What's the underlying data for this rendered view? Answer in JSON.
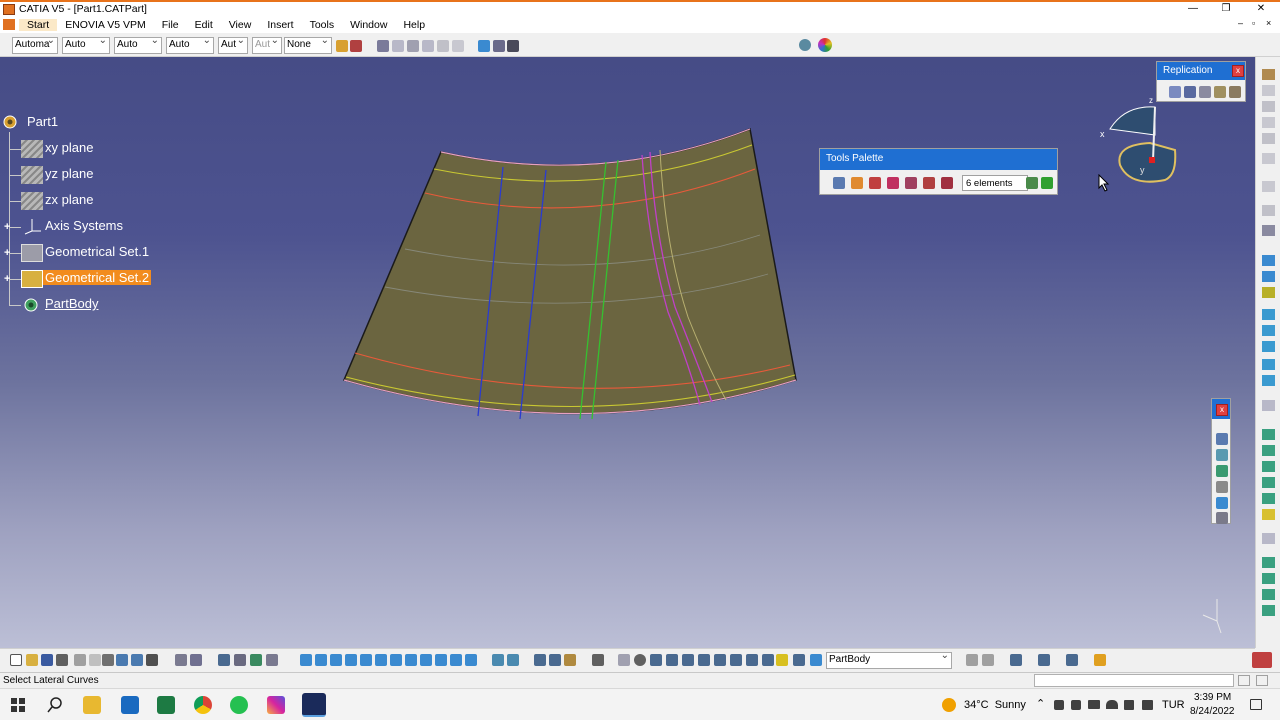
{
  "window": {
    "title": "CATIA V5 - [Part1.CATPart]",
    "minimize_icon": "minimize-icon",
    "maximize_icon": "maximize-icon",
    "close_icon": "close-icon"
  },
  "menu": [
    "Start",
    "ENOVIA V5 VPM",
    "File",
    "Edit",
    "View",
    "Insert",
    "Tools",
    "Window",
    "Help"
  ],
  "toolbar": {
    "combos": [
      "Automa",
      "Auto",
      "Auto",
      "Auto",
      "Aut",
      "Aut",
      "None"
    ]
  },
  "tree": {
    "root": "Part1",
    "items": [
      "xy plane",
      "yz plane",
      "zx plane",
      "Axis Systems",
      "Geometrical Set.1",
      "Geometrical Set.2",
      "PartBody"
    ],
    "selected": "Geometrical Set.2"
  },
  "replication": {
    "title": "Replication",
    "close": "x"
  },
  "tools_palette": {
    "title": "Tools Palette",
    "count": "6 elements"
  },
  "floating_toolbar": {
    "close": "x"
  },
  "compass": {
    "x_label": "x",
    "y_label": "y",
    "z_label": "z"
  },
  "bottom_bar": {
    "body_select": "PartBody"
  },
  "status": {
    "message": "Select Lateral Curves"
  },
  "taskbar": {
    "weather": "34°C  Sunny",
    "language": "TUR",
    "time": "3:39 PM",
    "date": "8/24/2022"
  },
  "colors": {
    "accent": "#1f6fd2",
    "selection": "#f28c1e",
    "surface": "#6b6540",
    "background_top": "#464c86"
  }
}
